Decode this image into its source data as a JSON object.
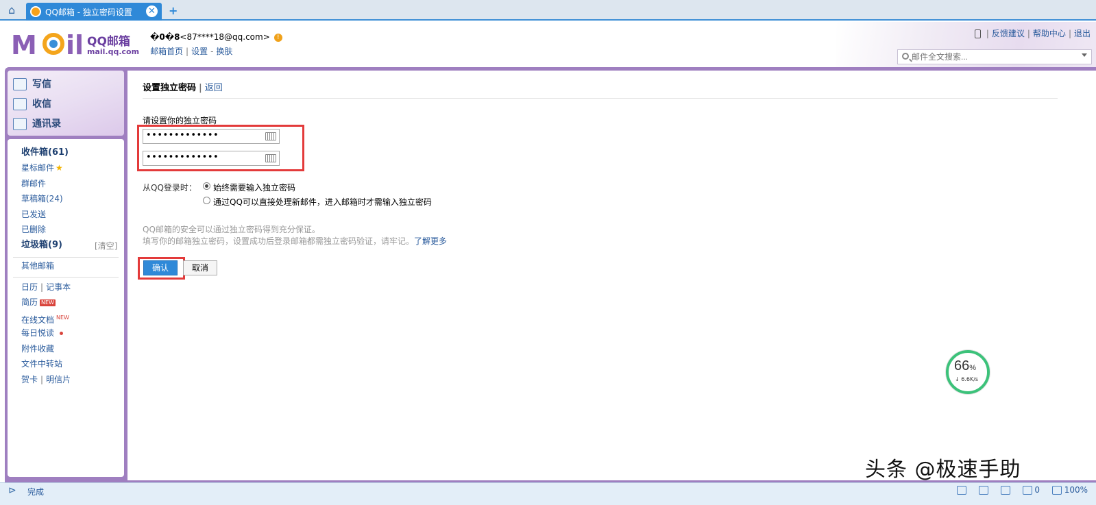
{
  "browser": {
    "tab_title": "QQ邮箱 - 独立密码设置",
    "close_glyph": "✕",
    "add_glyph": "+"
  },
  "header": {
    "brand_name": "QQ邮箱",
    "brand_url": "mail.qq.com",
    "account_name": "�0�8",
    "account_email": "<87****18@qq.com>",
    "links": [
      "邮箱首页",
      "设置",
      "换肤"
    ],
    "top_links": [
      "反馈建议",
      "帮助中心",
      "退出"
    ],
    "search_placeholder": "邮件全文搜索..."
  },
  "nav": {
    "write": "写信",
    "receive": "收信",
    "contacts": "通讯录"
  },
  "folders": {
    "inbox": "收件箱(61)",
    "starred": "星标邮件",
    "group": "群邮件",
    "drafts": "草稿箱(24)",
    "sent": "已发送",
    "deleted": "已删除",
    "spam": "垃圾箱(9)",
    "clear": "[清空]",
    "other": "其他邮箱",
    "calendar": "日历",
    "notes": "记事本",
    "resume": "简历",
    "online_docs": "在线文档",
    "daily": "每日悦读",
    "attachments": "附件收藏",
    "transfer": "文件中转站",
    "cards": "贺卡",
    "postcards": "明信片",
    "new_badge": "NEW"
  },
  "main": {
    "title": "设置独立密码",
    "back": "返回",
    "field_label": "请设置你的独立密码",
    "password_mask": "•••••••••••••",
    "confirm_mask": "•••••••••••••",
    "login_label": "从QQ登录时：",
    "option_1": "始终需要输入独立密码",
    "option_2": "通过QQ可以直接处理新邮件，进入邮箱时才需输入独立密码",
    "hint_1": "QQ邮箱的安全可以通过独立密码得到充分保证。",
    "hint_2": "填写你的邮箱独立密码，设置成功后登录邮箱都需独立密码验证，请牢记。",
    "learn_more": "了解更多",
    "confirm_btn": "确认",
    "cancel_btn": "取消"
  },
  "speed_widget": {
    "percent": "66",
    "percent_sign": "%",
    "rate": "↓ 6.6K/s"
  },
  "watermark": "头条 @极速手助",
  "statusbar": {
    "status": "完成",
    "tray_count": "0",
    "zoom": "100%"
  },
  "colors": {
    "accent": "#2f89d8",
    "frame": "#9f7fc0",
    "highlight": "#e33a3a",
    "link": "#2a5b9c"
  }
}
